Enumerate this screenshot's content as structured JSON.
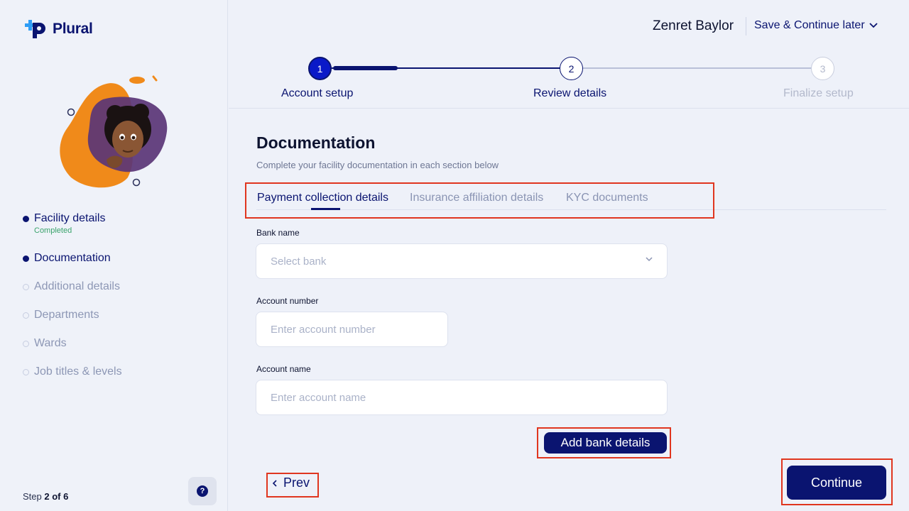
{
  "app": {
    "name": "Plural"
  },
  "sidebar": {
    "steps": [
      {
        "label": "Facility details",
        "sub": "Completed",
        "state": "done"
      },
      {
        "label": "Documentation",
        "state": "active"
      },
      {
        "label": "Additional details",
        "state": "inactive"
      },
      {
        "label": "Departments",
        "state": "inactive"
      },
      {
        "label": "Wards",
        "state": "inactive"
      },
      {
        "label": "Job titles & levels",
        "state": "inactive"
      }
    ],
    "step_count_prefix": "Step",
    "step_count_value": "2 of 6",
    "help_label": "?"
  },
  "header": {
    "user_name": "Zenret Baylor",
    "save_later": "Save & Continue later"
  },
  "progress": {
    "steps": [
      {
        "number": "1",
        "label": "Account setup",
        "state": "done"
      },
      {
        "number": "2",
        "label": "Review details",
        "state": "current"
      },
      {
        "number": "3",
        "label": "Finalize setup",
        "state": "future"
      }
    ],
    "current_progress": 0.28
  },
  "main": {
    "title": "Documentation",
    "subtitle": "Complete your facility documentation in each section below",
    "tabs": [
      {
        "label": "Payment collection details",
        "active": true
      },
      {
        "label": "Insurance affiliation details",
        "active": false
      },
      {
        "label": "KYC documents",
        "active": false
      }
    ],
    "form": {
      "bank_name_label": "Bank name",
      "bank_name_placeholder": "Select bank",
      "account_number_label": "Account number",
      "account_number_placeholder": "Enter account number",
      "account_name_label": "Account name",
      "account_name_placeholder": "Enter account name",
      "add_bank_button": "Add bank details"
    },
    "prev_button": "Prev",
    "continue_button": "Continue"
  },
  "colors": {
    "primary": "#0a1470",
    "accent_step": "#0a19c8",
    "completed_green": "#39a36b",
    "highlight_red": "#e0361f"
  }
}
